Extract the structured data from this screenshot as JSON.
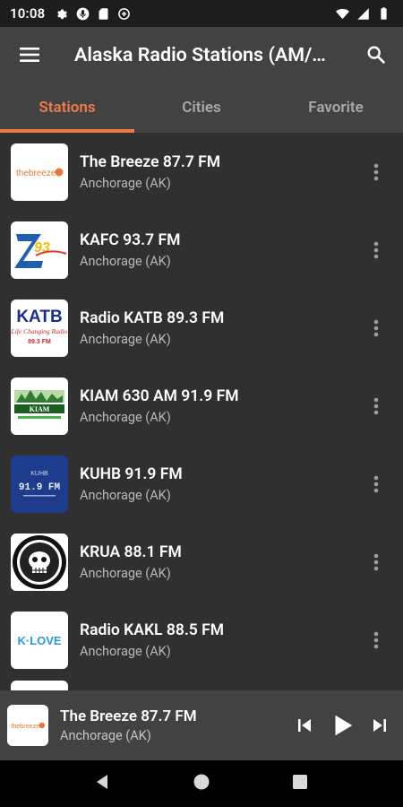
{
  "status_bar": {
    "time": "10:08",
    "left_icons": [
      "settings-icon",
      "mic-icon",
      "sim-card-icon",
      "data-saver-icon"
    ],
    "right_icons": [
      "wifi-icon",
      "signal-icon",
      "battery-icon"
    ]
  },
  "app_bar": {
    "title": "Alaska Radio Stations (AM/…",
    "menu_icon": "hamburger-menu-icon",
    "search_icon": "search-icon"
  },
  "tabs": [
    {
      "label": "Stations",
      "active": true
    },
    {
      "label": "Cities",
      "active": false
    },
    {
      "label": "Favorite",
      "active": false
    }
  ],
  "stations": [
    {
      "name": "The Breeze 87.7 FM",
      "city": "Anchorage (AK)",
      "logo": "thebreeze-logo"
    },
    {
      "name": "KAFC 93.7 FM",
      "city": "Anchorage (AK)",
      "logo": "kafc-logo"
    },
    {
      "name": "Radio KATB 89.3 FM",
      "city": "Anchorage (AK)",
      "logo": "katb-logo"
    },
    {
      "name": "KIAM 630 AM 91.9 FM",
      "city": "Anchorage (AK)",
      "logo": "kiam-logo"
    },
    {
      "name": "KUHB 91.9 FM",
      "city": "Anchorage (AK)",
      "logo": "kuhb-logo"
    },
    {
      "name": "KRUA 88.1 FM",
      "city": "Anchorage (AK)",
      "logo": "krua-logo"
    },
    {
      "name": "Radio KAKL 88.5 FM",
      "city": "Anchorage (AK)",
      "logo": "klove-logo"
    }
  ],
  "logo_text": {
    "thebreeze": "thebreeze",
    "katb": "KATB",
    "katb_sub": "Life Changing Radio",
    "katb_freq": "89.3 FM",
    "kiam": "KIAM",
    "kuhb_top": "KUHB",
    "kuhb_freq": "91.9 FM",
    "klove": "K·LOVE"
  },
  "player": {
    "name": "The Breeze 87.7 FM",
    "city": "Anchorage (AK)",
    "controls": [
      "skip-previous-icon",
      "play-icon",
      "skip-next-icon"
    ]
  },
  "nav_bar": [
    "back-icon",
    "home-icon",
    "recents-icon"
  ],
  "colors": {
    "accent": "#ef7b49",
    "app_bar": "#424242",
    "list_bg": "#303030"
  }
}
